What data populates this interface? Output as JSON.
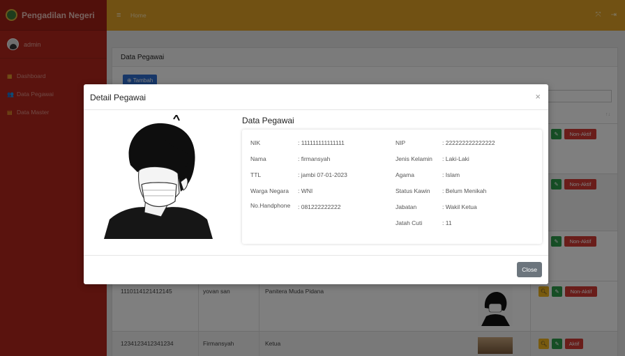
{
  "app": {
    "brand": "Pengadilan Negeri",
    "user": "admin"
  },
  "sidebar": {
    "items": [
      {
        "label": "Dashboard",
        "icon": "grid-icon"
      },
      {
        "label": "Data Pegawai",
        "icon": "users-icon"
      },
      {
        "label": "Data Master",
        "icon": "database-icon"
      }
    ]
  },
  "topbar": {
    "home": "Home",
    "menu_icon": "≡",
    "expand_icon": "⤧",
    "logout_icon": "⇥"
  },
  "page": {
    "card_title": "Data Pegawai",
    "add_button": "Tambah",
    "sort_note": "↑↓"
  },
  "table": {
    "rows": [
      {
        "nik": "",
        "nama": "",
        "jabatan": "",
        "actions": [
          "edit",
          "Non-Aktif"
        ]
      },
      {
        "nik": "",
        "nama": "",
        "jabatan": "",
        "actions": [
          "edit",
          "Non-Aktif"
        ]
      },
      {
        "nik": "",
        "nama": "",
        "jabatan": "",
        "actions": [
          "edit",
          "Non-Aktif"
        ]
      },
      {
        "nik": "1110114121412145",
        "nama": "yovan san",
        "jabatan": "Panitera Muda Pidana",
        "actions": [
          "view",
          "edit",
          "Non-Aktif"
        ]
      },
      {
        "nik": "1234123412341234",
        "nama": "Firmansyah",
        "jabatan": "Ketua",
        "actions": [
          "view",
          "edit",
          "Aktif"
        ]
      }
    ]
  },
  "modal": {
    "title": "Detail Pegawai",
    "close_x": "×",
    "section_title": "Data Pegawai",
    "left_fields": [
      {
        "label": "NIK",
        "value": ": 111111111111111"
      },
      {
        "label": "Nama",
        "value": ": firmansyah"
      },
      {
        "label": "TTL",
        "value": ": jambi 07-01-2023"
      },
      {
        "label": "Warga Negara",
        "value": ": WNI"
      },
      {
        "label": "No.Handphone",
        "value": ": 081222222222"
      }
    ],
    "right_fields": [
      {
        "label": "NIP",
        "value": ": 222222222222222"
      },
      {
        "label": "Jenis Kelamin",
        "value": ": Laki-Laki"
      },
      {
        "label": "Agama",
        "value": ": Islam"
      },
      {
        "label": "Status Kawin",
        "value": ": Belum Menikah"
      },
      {
        "label": "Jabatan",
        "value": ": Wakil Ketua"
      },
      {
        "label": "Jatah Cuti",
        "value": ": 11"
      }
    ],
    "close_button": "Close"
  },
  "colors": {
    "sidebar": "#b5271c",
    "topbar": "#e3a326",
    "primary": "#2f6fd1",
    "danger": "#d23a35",
    "success": "#2d9c4a",
    "warning": "#f0b51c"
  }
}
